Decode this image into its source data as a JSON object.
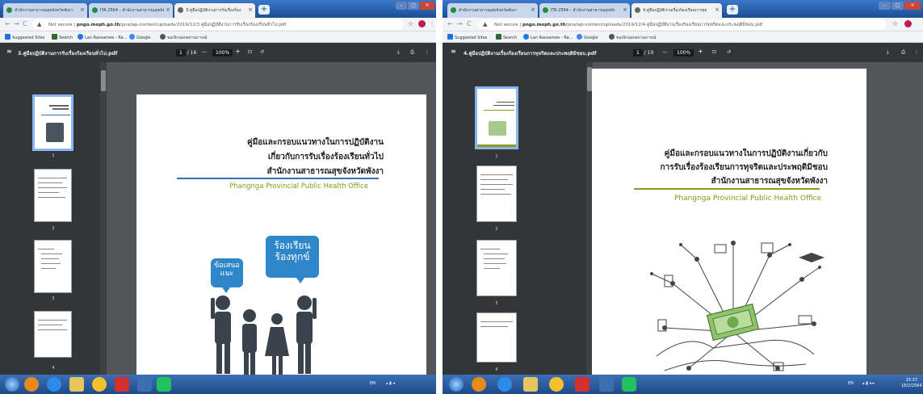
{
  "left": {
    "tabs": [
      {
        "title": "สำนักงานสาธารณสุขจังหวัดพังงา",
        "active": false
      },
      {
        "title": "ITA 2564 – สำนักงานสาธารณสุขจัง",
        "active": false
      },
      {
        "title": "3.คู่มือปฏิบัติงานการรับเรื่องร้อง",
        "active": true
      }
    ],
    "address": {
      "security": "Not secure",
      "domain": "pngo.moph.go.th",
      "path": "/pna/wp-content/uploads/2019/12/3.คู่มือปฏิบัติงานการรับเรื่องร้องเรียนทั่วไป.pdf"
    },
    "bookmarks": [
      "Suggested Sites",
      "Search",
      "Lan Rassamee - Ra...",
      "Google",
      "ขอเบิกนอกสถานการณ์"
    ],
    "pdf": {
      "filename": "3.คู่มือปฏิบัติงานการรับเรื่องร้องเรียนทั่วไป.pdf",
      "page": "1",
      "total": "/ 16",
      "zoom": "100%"
    },
    "thumbs": [
      "1",
      "2",
      "3",
      "4"
    ],
    "doc": {
      "title_lines": [
        "คู่มือและกรอบแนวทางในการปฏิบัติงาน",
        "เกี่ยวกับการรับเรื่องร้องเรียนทั่วไป",
        "สำนักงานสาธารณสุขจังหวัดพังงา"
      ],
      "subtitle": "Phangnga Provincial Public Health Office",
      "bubble_small": [
        "ข้อเสนอ",
        "แนะ"
      ],
      "bubble_big": [
        "ร้องเรียน",
        "ร้องทุกข์"
      ]
    },
    "tray": {
      "lang": "EN"
    }
  },
  "right": {
    "tabs": [
      {
        "title": "สำนักงานสาธารณสุขจังหวัดพังงา",
        "active": false
      },
      {
        "title": "ITA 2564 – สำนักงานสาธารณสุขจัง",
        "active": false
      },
      {
        "title": "4.คู่มือปฏิบัติงานเรื่องร้องเรียนการทุจ",
        "active": true
      }
    ],
    "address": {
      "security": "Not secure",
      "domain": "pngo.moph.go.th",
      "path": "/pna/wp-content/uploads/2019/12/4.คู่มือปฏิบัติงานเรื่องร้องเรียนการทุจริตและประพฤติมิชอบ.pdf"
    },
    "bookmarks": [
      "Suggested Sites",
      "Search",
      "Lan Rassamee - Ra...",
      "Google",
      "ขอเบิกนอกสถานการณ์"
    ],
    "pdf": {
      "filename": "4.คู่มือปฏิบัติงานเรื่องร้องเรียนการทุจริตและประพฤติมิชอบ.pdf",
      "page": "1",
      "total": "/ 19",
      "zoom": "100%"
    },
    "thumbs": [
      "1",
      "2",
      "3",
      "4"
    ],
    "doc": {
      "title_lines": [
        "คู่มือและกรอบแนวทางในการปฏิบัติงานเกี่ยวกับ",
        "การรับเรื่องร้องเรียนการทุจริตและประพฤติมิชอบ",
        "สำนักงานสาธารณสุขจังหวัดพังงา"
      ],
      "subtitle": "Phangnga Provincial Public Health Office"
    },
    "tray": {
      "lang": "EN",
      "time": "15:37",
      "date": "18/2/2564"
    }
  },
  "colors": {
    "accent_blue": "#2f86c9",
    "olive": "#8a9a1a",
    "rule_blue": "#3d6fb8"
  }
}
